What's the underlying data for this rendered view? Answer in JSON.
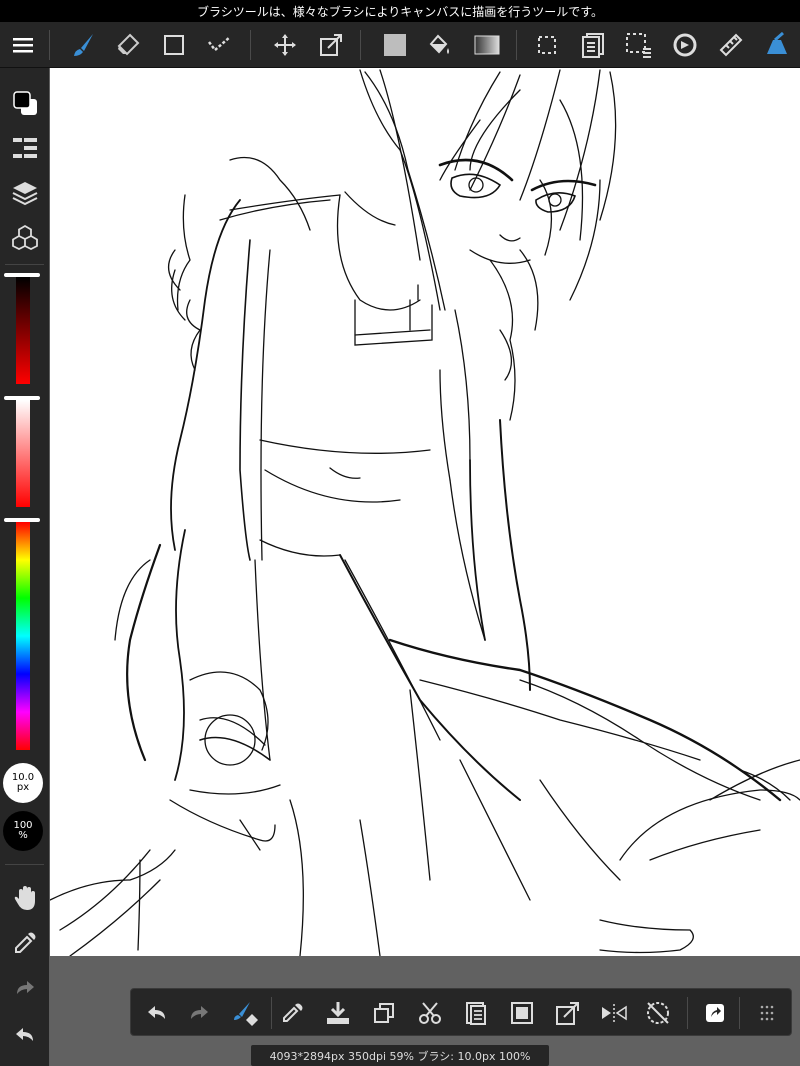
{
  "tip": {
    "text": "ブラシツールは、様々なブラシによりキャンバスに描画を行うツールです。"
  },
  "colors": {
    "accent": "#3a8fd6",
    "toolbar_bg": "#262626",
    "canvas_bg": "#ffffff",
    "outer_bg": "#616161"
  },
  "top_toolbar": {
    "items": [
      "menu-icon",
      "brush-tool-icon",
      "eraser-tool-icon",
      "shape-tool-icon",
      "select-check-icon",
      "move-tool-icon",
      "transform-tool-icon",
      "fill-color-icon",
      "bucket-tool-icon",
      "gradient-tool-icon",
      "select-rect-icon",
      "layer-list-icon",
      "selection-menu-icon",
      "rotate-canvas-icon",
      "ruler-icon",
      "brush-settings-icon"
    ]
  },
  "left_panel": {
    "brush_size": {
      "value": "10.0",
      "unit": "px"
    },
    "opacity": {
      "value": "100",
      "unit": "%"
    },
    "slider_levels": {
      "color": 1.0,
      "saturation": 1.0,
      "hue": 0.0
    }
  },
  "bottom_toolbar": {
    "items": [
      "undo-icon",
      "redo-icon",
      "clear-icon",
      "eyedropper-icon",
      "save-icon",
      "duplicate-icon",
      "cut-icon",
      "paste-icon",
      "select-all-icon",
      "export-icon",
      "flip-icon",
      "rotate-icon",
      "share-icon",
      "more-icon"
    ]
  },
  "status": {
    "text": "4093*2894px 350dpi 59% ブラシ: 10.0px 100%"
  }
}
